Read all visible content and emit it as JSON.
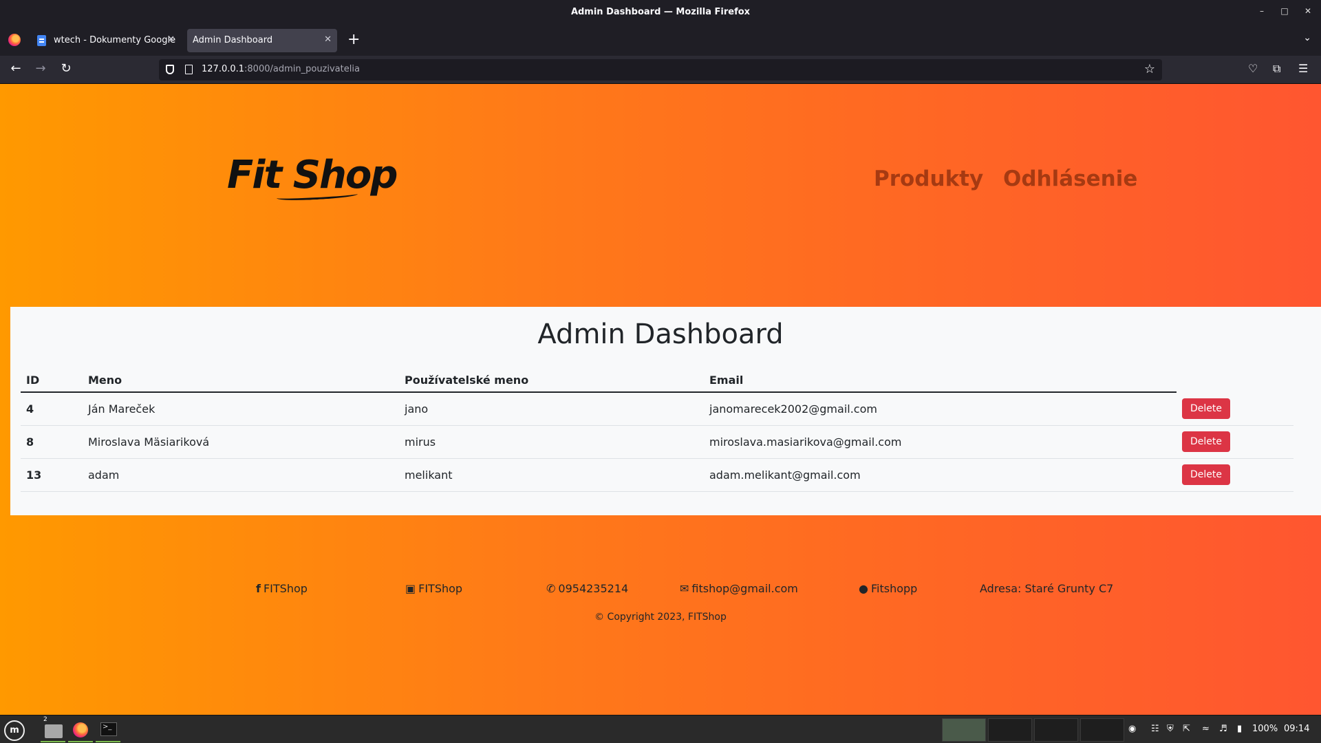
{
  "window": {
    "title": "Admin Dashboard — Mozilla Firefox"
  },
  "tabs": [
    {
      "label": "wtech - Dokumenty Google"
    },
    {
      "label": "Admin Dashboard"
    }
  ],
  "urlbar": {
    "host": "127.0.0.1",
    "rest": ":8000/admin_pouzivatelia"
  },
  "site": {
    "logo_text": "Fit Shop",
    "nav": [
      "Produkty",
      "Odhlásenie"
    ]
  },
  "dashboard": {
    "title": "Admin Dashboard",
    "columns": [
      "ID",
      "Meno",
      "Používatelské meno",
      "Email"
    ],
    "rows": [
      {
        "id": "4",
        "name": "Ján Mareček",
        "username": "jano",
        "email": "janomarecek2002@gmail.com"
      },
      {
        "id": "8",
        "name": "Miroslava Mäsiariková",
        "username": "mirus",
        "email": "miroslava.masiarikova@gmail.com"
      },
      {
        "id": "13",
        "name": "adam",
        "username": "melikant",
        "email": "adam.melikant@gmail.com"
      }
    ],
    "delete_label": "Delete",
    "delete_color": "#dc3545"
  },
  "footer": {
    "facebook": "FITShop",
    "instagram": "FITShop",
    "phone": "0954235214",
    "email": "fitshop@gmail.com",
    "other": "Fitshopp",
    "address": "Adresa: Staré Grunty C7",
    "copyright": "© Copyright 2023, FITShop"
  },
  "taskbar": {
    "files_badge": "2",
    "battery": "100%",
    "clock": "09:14"
  },
  "icons": {
    "facebook": "facebook-icon",
    "instagram": "instagram-icon",
    "phone": "phone-icon",
    "email": "envelope-icon",
    "other": "user-circle-icon"
  }
}
